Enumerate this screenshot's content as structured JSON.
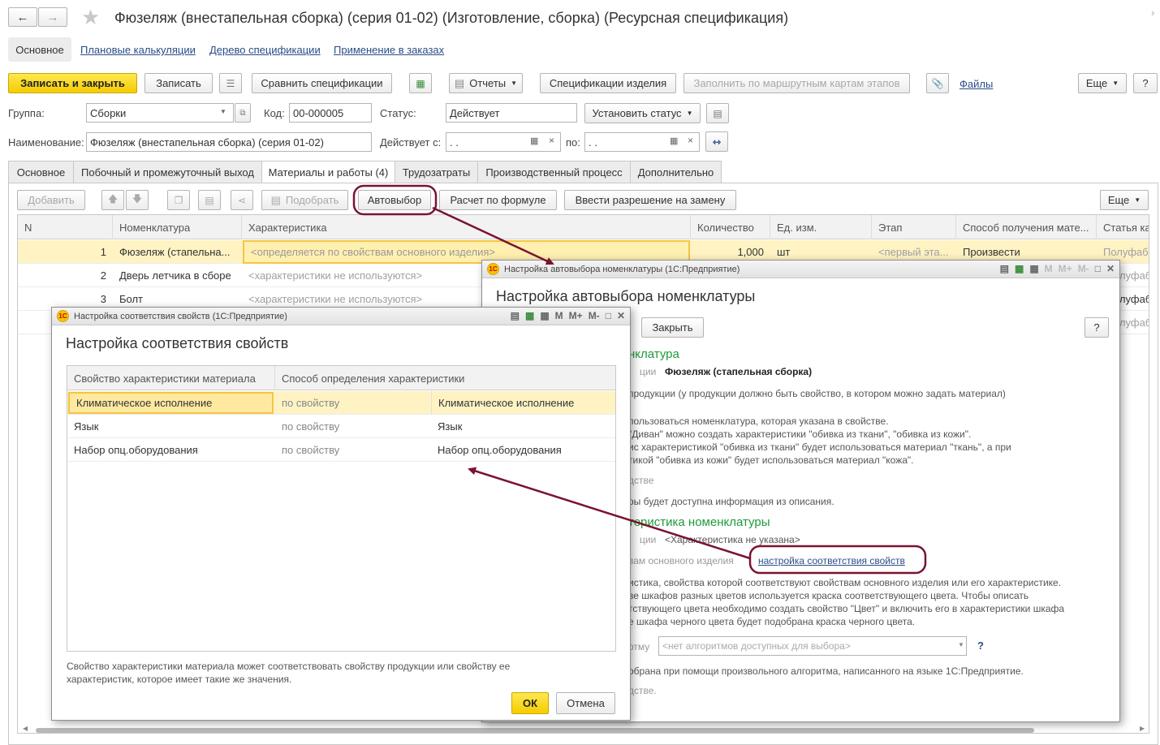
{
  "header": {
    "title": "Фюзеляж (внестапельная сборка) (серия 01-02) (Изготовление, сборка) (Ресурсная спецификация)",
    "nav": [
      "Основное",
      "Плановые калькуляции",
      "Дерево спецификации",
      "Применение в заказах"
    ]
  },
  "toolbar": {
    "save_close": "Записать и закрыть",
    "save": "Записать",
    "compare": "Сравнить спецификации",
    "reports": "Отчеты",
    "specs": "Спецификации изделия",
    "fill": "Заполнить по маршрутным картам этапов",
    "files": "Файлы",
    "more": "Еще",
    "help": "?"
  },
  "form": {
    "group_label": "Группа:",
    "group_value": "Сборки",
    "code_label": "Код:",
    "code_value": "00-000005",
    "status_label": "Статус:",
    "status_value": "Действует",
    "set_status": "Установить статус",
    "name_label": "Наименование:",
    "name_value": "Фюзеляж (внестапельная сборка) (серия 01-02)",
    "valid_from_label": "Действует с:",
    "date_empty": " .  .",
    "to_label": "по:"
  },
  "tabs": [
    "Основное",
    "Побочный и промежуточный выход",
    "Материалы и работы (4)",
    "Трудозатраты",
    "Производственный процесс",
    "Дополнительно"
  ],
  "table_toolbar": {
    "add": "Добавить",
    "pick": "Подобрать",
    "autoselect": "Автовыбор",
    "formula": "Расчет по формуле",
    "replace": "Ввести разрешение на замену",
    "more": "Еще"
  },
  "table": {
    "headers": [
      "N",
      "Номенклатура",
      "Характеристика",
      "Количество",
      "Ед. изм.",
      "Этап",
      "Способ получения мате...",
      "Статья ка"
    ],
    "rows": [
      {
        "n": "1",
        "nom": "Фюзеляж (стапельна...",
        "char": "<определяется по свойствам основного изделия>",
        "qty": "1,000",
        "unit": "шт",
        "stage": "<первый эта...",
        "method": "Произвести",
        "article": "Полуфабр"
      },
      {
        "n": "2",
        "nom": "Дверь летчика в сборе",
        "char": "<характеристики не используются>",
        "qty": "",
        "unit": "",
        "stage": "",
        "method": "",
        "article": "олуфабр"
      },
      {
        "n": "3",
        "nom": "Болт",
        "char": "<характеристики не используются>",
        "qty": "",
        "unit": "",
        "stage": "",
        "method": "",
        "article": "олуфабр"
      },
      {
        "n": "",
        "nom": "",
        "char": "",
        "qty": "",
        "unit": "",
        "stage": "",
        "method": "",
        "article": "олуфабр"
      }
    ]
  },
  "autoselect_win": {
    "title": "Настройка автовыбора номенклатуры  (1С:Предприятие)",
    "heading": "Настройка автовыбора номенклатуры",
    "close": "Закрыть",
    "help": "?",
    "sec1": "нклатура",
    "label1": "ции",
    "value1": "Фюзеляж (стапельная сборка)",
    "line2": "продукции (у продукции должно быть свойство, в котором можно задать материал)",
    "line3": "пользоваться номенклатура, которая указана в свойстве.",
    "line4": "\"Диван\" можно создать характеристики \"обивка из ткани\", \"обивка из кожи\".",
    "line5": "ис характеристикой \"обивка из ткани\" будет использоваться материал \"ткань\", а при",
    "line6": "тикой \"обивка из кожи\" будет использоваться материал \"кожа\".",
    "line7": "дстве",
    "line8": "ры будет доступна информация из описания.",
    "sec2": "теристика номенклатуры",
    "label2": "ции",
    "value2": "<Характеристика не указана>",
    "line9": "вам основного изделия",
    "link": "настройка соответствия свойств",
    "line10": "истика, свойства которой соответствуют свойствам основного изделия или его характеристике.",
    "line11": "ве шкафов разных цветов используется краска соответствующего цвета. Чтобы описать",
    "line12": "тствующего цвета необходимо создать свойство \"Цвет\" и включить его в характеристики шкафа",
    "line13": "е шкафа черного цвета будет подобрана краска черного цвета.",
    "label3": "ртму",
    "algo_placeholder": "<нет алгоритмов доступных для выбора>",
    "line14": "обрана при помощи произвольного алгоритма, написанного на языке 1С:Предприятие.",
    "line15": "дстве."
  },
  "props_win": {
    "title": "Настройка соответствия свойств  (1С:Предприятие)",
    "heading": "Настройка соответствия свойств",
    "headers": [
      "Свойство характеристики материала",
      "Способ определения характеристики"
    ],
    "rows": [
      {
        "prop": "Климатическое исполнение",
        "method": "по свойству",
        "value": "Климатическое исполнение"
      },
      {
        "prop": "Язык",
        "method": "по свойству",
        "value": "Язык"
      },
      {
        "prop": "Набор опц.оборудования",
        "method": "по свойству",
        "value": "Набор опц.оборудования"
      }
    ],
    "note": "Свойство характеристики материала может соответствовать свойству продукции или свойству ее характеристик, которое имеет такие же значения.",
    "ok": "ОК",
    "cancel": "Отмена"
  },
  "win_icons": {
    "m": "M",
    "mplus": "M+",
    "mminus": "M-"
  },
  "colors": {
    "accent_yellow": "#f5cc00",
    "highlight": "#fff3c4",
    "annotation": "#7a1230",
    "green": "#1f9a3b",
    "link": "#2a4d87"
  }
}
